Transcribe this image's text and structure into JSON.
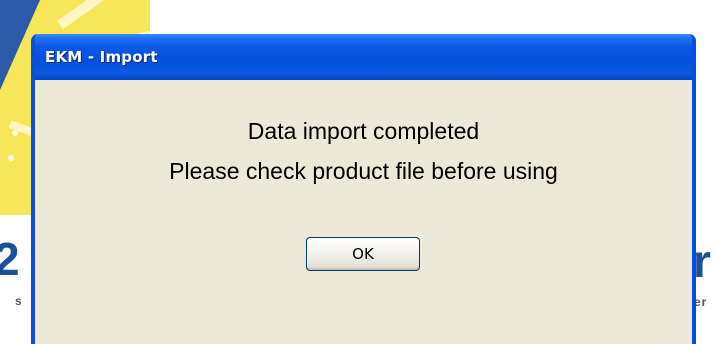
{
  "window": {
    "title": "EKM - Import"
  },
  "dialog": {
    "message_line1": "Data import completed",
    "message_line2": "Please check product file before using",
    "ok_label": "OK"
  },
  "background_app": {
    "left_letter": "2",
    "left_small_text": "s",
    "right_letter": "r",
    "right_small_text": "er"
  },
  "colors": {
    "titlebar_blue": "#0a58e3",
    "dialog_face": "#ece9d8",
    "logo_yellow": "#f7e55a",
    "logo_blue": "#1e4f9a"
  }
}
